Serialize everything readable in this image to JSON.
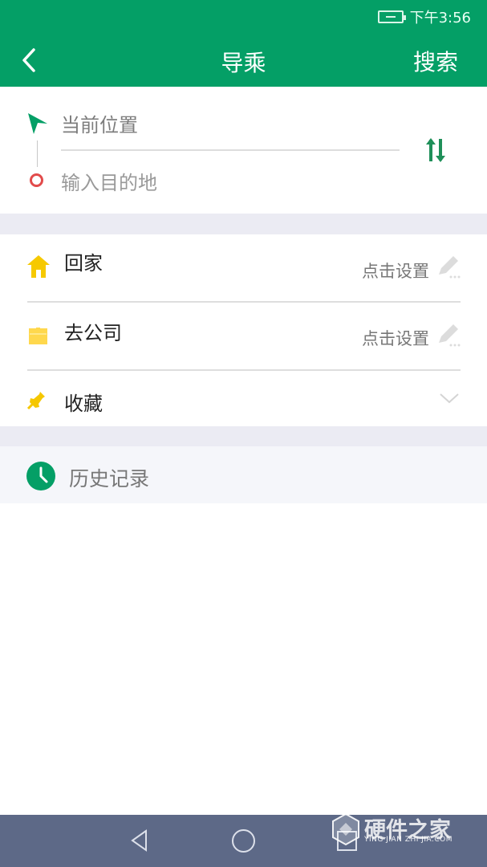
{
  "status_bar": {
    "time": "下午3:56"
  },
  "header": {
    "title": "导乘",
    "search_label": "搜索"
  },
  "route": {
    "start_text": "当前位置",
    "destination_placeholder": "输入目的地"
  },
  "quick_items": [
    {
      "label": "回家",
      "action": "点击设置"
    },
    {
      "label": "去公司",
      "action": "点击设置"
    },
    {
      "label": "收藏"
    }
  ],
  "history": {
    "label": "历史记录"
  },
  "watermark": {
    "text": "硬件之家",
    "subtitle": "YING JIAN ZHI JIA.COM"
  },
  "colors": {
    "brand": "#049f66",
    "accent": "#1f8f59",
    "home_icon": "#f6c900",
    "work_icon": "#ffd84d",
    "destination": "#e24b4b",
    "nav_bar": "#5d6987"
  },
  "icons": {
    "back": "chevron-left-icon",
    "swap": "swap-vertical-icon",
    "home": "home-icon",
    "work": "briefcase-icon",
    "favorite": "pin-icon",
    "history": "clock-icon"
  }
}
